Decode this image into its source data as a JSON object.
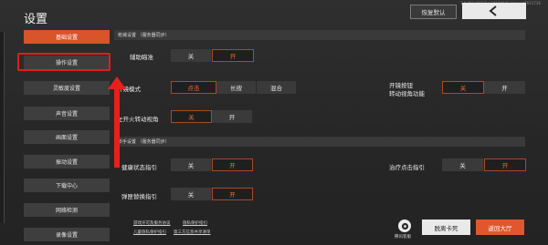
{
  "header": {
    "title": "设置",
    "version_text": "1.0.702.69321 | 1918002S | Userid7641736",
    "reset_label": "恢复默认"
  },
  "sidebar": {
    "items": [
      {
        "label": "基础设置",
        "active": true
      },
      {
        "label": "操作设置",
        "active": false
      },
      {
        "label": "灵敏度设置",
        "active": false
      },
      {
        "label": "声音设置",
        "active": false
      },
      {
        "label": "画面设置",
        "active": false
      },
      {
        "label": "振动设置",
        "active": false
      },
      {
        "label": "下载中心",
        "active": false
      },
      {
        "label": "网络检测",
        "active": false
      },
      {
        "label": "录像设置",
        "active": false
      }
    ]
  },
  "sections": {
    "gun": "枪械设置 （服务器同步）",
    "newbie": "新手设置 （服务器同步）"
  },
  "settings": {
    "aim_assist": {
      "label": "辅助瞄准",
      "off": "关",
      "on": "开"
    },
    "scope_mode": {
      "label": "开镜模式",
      "opt1": "点击",
      "opt2": "长按",
      "opt3": "混合"
    },
    "scope_button_view": {
      "label1": "开镜按钮",
      "label2": "转动视角功能",
      "off": "关",
      "on": "开"
    },
    "fire_turn_view": {
      "label": "左开火转动视角",
      "off": "关",
      "on": "开"
    },
    "health_guide": {
      "label": "健康状态指引",
      "off": "关",
      "on": "开"
    },
    "heal_guide": {
      "label": "治疗点击指引",
      "off": "关",
      "on": "开"
    },
    "ammo_guide": {
      "label": "弹匣替换指引",
      "off": "关",
      "on": "开"
    }
  },
  "links": {
    "l1": "游戏许可及服务协议",
    "l2": "隐私保护指引",
    "l3": "儿童隐私保护指引",
    "l4": "第三方信息共享清单"
  },
  "footer": {
    "spirit_label": "腾讯客服",
    "leave_label": "脱离卡死",
    "lobby_label": "返回大厅"
  },
  "colors": {
    "accent": "#d9532b",
    "highlight_box": "#e21d1d"
  }
}
